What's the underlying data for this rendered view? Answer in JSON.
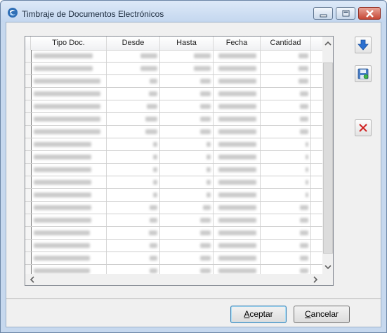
{
  "window": {
    "title": "Timbraje de Documentos Electrónicos",
    "controls": [
      "minimize",
      "maximize",
      "close"
    ]
  },
  "grid": {
    "columns": [
      "Tipo Doc.",
      "Desde",
      "Hasta",
      "Fecha",
      "Cantidad"
    ],
    "row_count": 19,
    "rows_note": "cell contents blurred/unreadable"
  },
  "side_buttons": [
    {
      "icon": "arrow-down-icon"
    },
    {
      "icon": "save-disk-icon"
    },
    {
      "icon": "delete-x-icon"
    }
  ],
  "footer": {
    "accept_mnemonic": "A",
    "accept_rest": "ceptar",
    "cancel_mnemonic": "C",
    "cancel_rest": "ancelar"
  },
  "colors": {
    "title_bar": "#c4d7ef",
    "close_button": "#c64735",
    "arrow_blue": "#2a6fd0",
    "delete_red": "#d02020"
  }
}
